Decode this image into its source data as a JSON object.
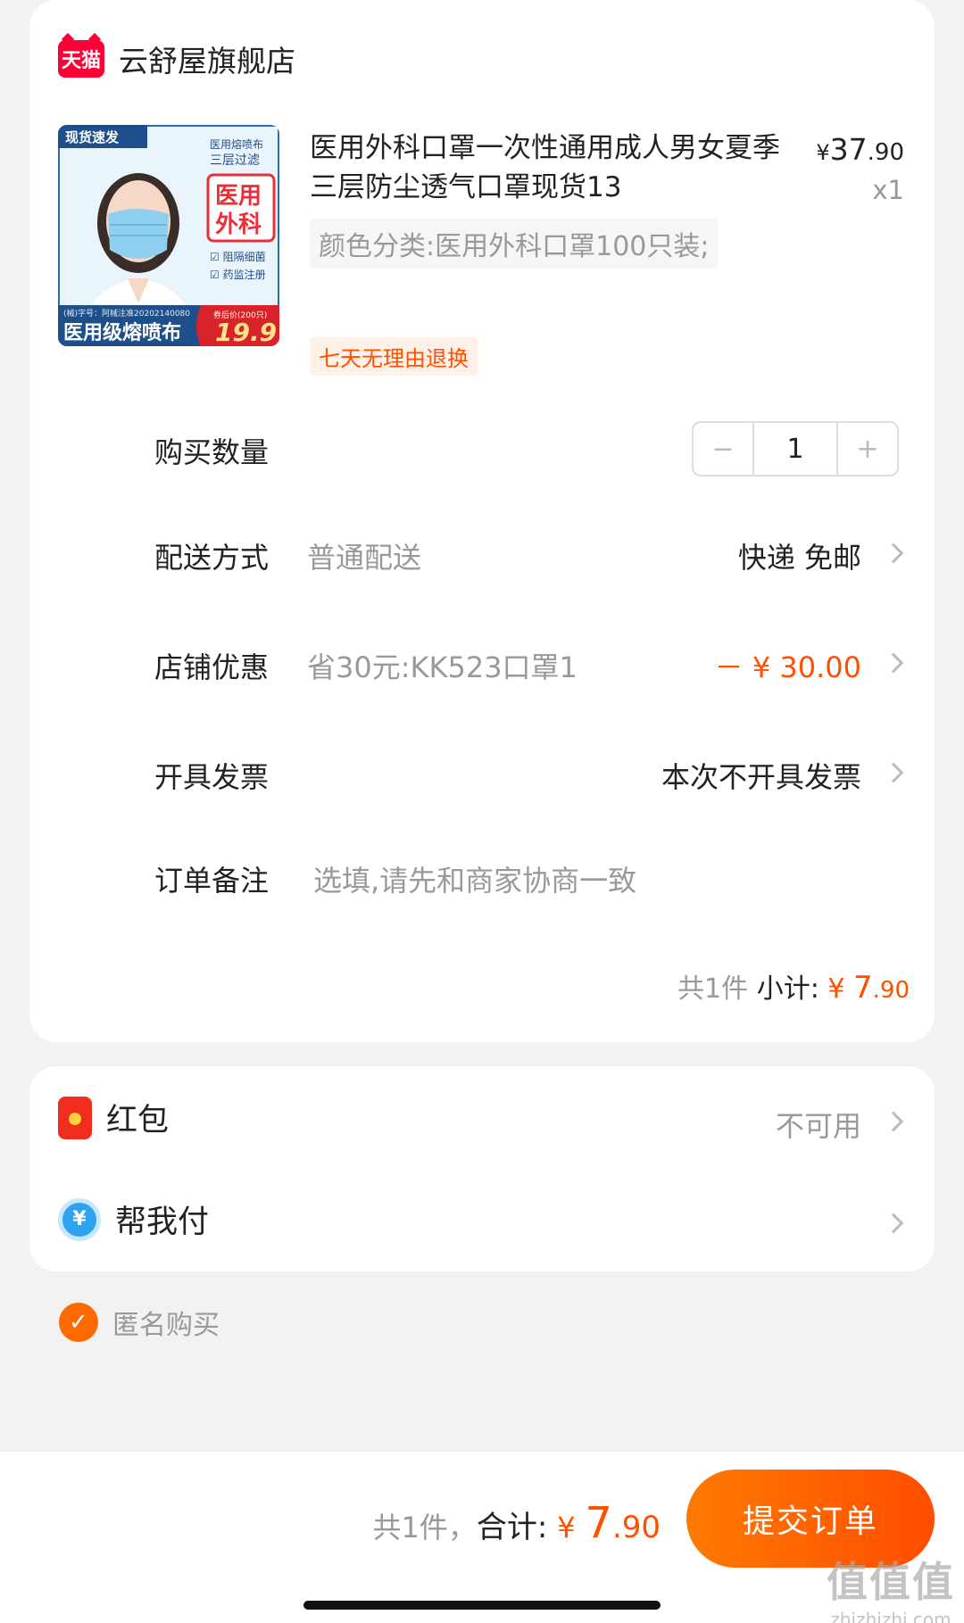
{
  "store": {
    "logo_text": "天猫",
    "name": "云舒屋旗舰店"
  },
  "product": {
    "title": "医用外科口罩一次性通用成人男女夏季三层防尘透气口罩现货13",
    "price": {
      "symbol": "¥",
      "main": "37",
      "cents": ".90"
    },
    "qty": "x1",
    "sku": "颜色分类:医用外科口罩100只装;",
    "return_tag": "七天无理由退换",
    "image": {
      "badge": "现货速发",
      "side_text_1": "医用熔喷布",
      "side_text_2": "三层过滤",
      "main_text_1": "医用",
      "main_text_2": "外科",
      "check_1": "阻隔细菌",
      "check_2": "药监注册",
      "cert_small": "(械)字号：阿械注准20202140080",
      "bottom_text": "医用级熔喷布",
      "price_caption": "券后价(200只)",
      "price_big": "19.9"
    }
  },
  "rows": {
    "quantity": {
      "label": "购买数量",
      "value": "1",
      "minus": "−",
      "plus": "+"
    },
    "delivery": {
      "label": "配送方式",
      "sub": "普通配送",
      "value": "快递 免邮"
    },
    "discount": {
      "label": "店铺优惠",
      "sub": "省30元:KK523口罩1",
      "value": "－ ¥ 30.00"
    },
    "invoice": {
      "label": "开具发票",
      "value": "本次不开具发票"
    },
    "note": {
      "label": "订单备注",
      "placeholder": "选填,请先和商家协商一致"
    }
  },
  "subtotal": {
    "count": "共1件",
    "label": "小计:",
    "symbol": "¥",
    "main": "7",
    "cents": ".90"
  },
  "payment": {
    "redpacket": {
      "label": "红包",
      "value": "不可用"
    },
    "helppay": {
      "label": "帮我付",
      "icon_char": "¥"
    }
  },
  "anonymous": {
    "label": "匿名购买",
    "checked": true,
    "check_char": "✓"
  },
  "bottom": {
    "count": "共1件，",
    "total_label": "合计:",
    "symbol": "¥",
    "main": "7",
    "cents": ".90",
    "submit": "提交订单"
  },
  "watermark": {
    "main": "值值值",
    "sub": "zhizhizhi.com"
  },
  "colors": {
    "accent": "#ff5000",
    "tmall": "#ff0036",
    "bg": "#f2f2f2"
  }
}
